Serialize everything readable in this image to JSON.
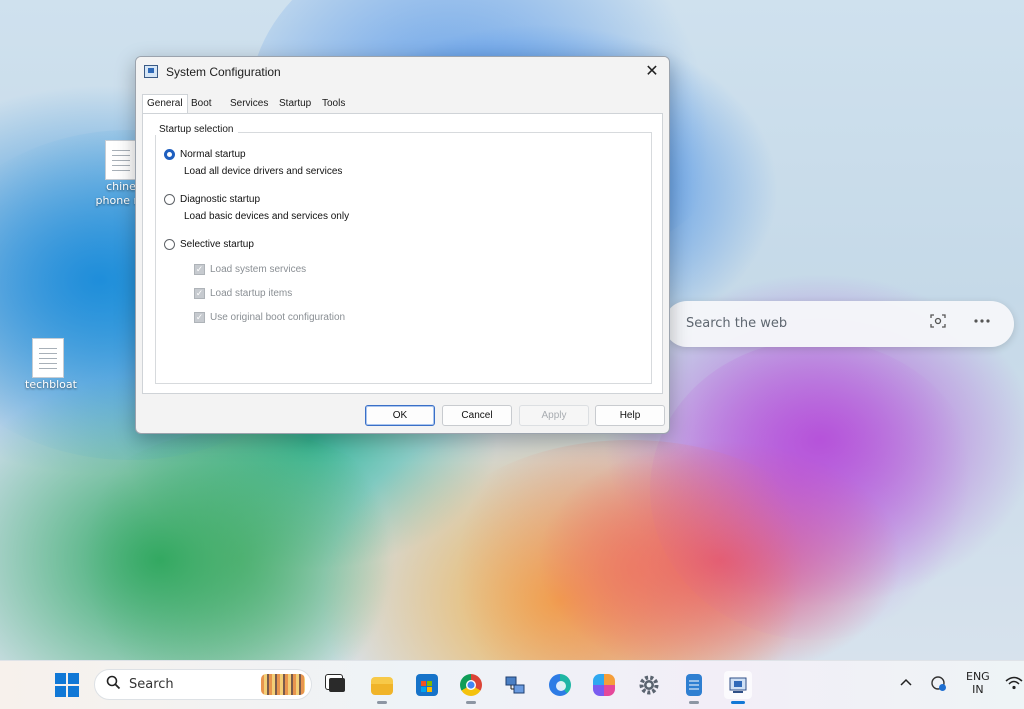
{
  "desktop": {
    "icons": [
      {
        "label_line1": "chine",
        "label_line2": "phone n"
      },
      {
        "label_line1": "techbloat"
      }
    ],
    "web_search": {
      "placeholder": "Search the web"
    }
  },
  "dialog": {
    "title": "System Configuration",
    "close_glyph": "✕",
    "tabs": [
      "General",
      "Boot",
      "Services",
      "Startup",
      "Tools"
    ],
    "active_tab": "General",
    "startup_selection": {
      "title": "Startup selection",
      "normal": {
        "label": "Normal startup",
        "desc": "Load all device drivers and services",
        "checked": true
      },
      "diagnostic": {
        "label": "Diagnostic startup",
        "desc": "Load basic devices and services only",
        "checked": false
      },
      "selective": {
        "label": "Selective startup",
        "checked": false,
        "options": [
          {
            "label": "Load system services",
            "checked": true,
            "disabled": true
          },
          {
            "label": "Load startup items",
            "checked": true,
            "disabled": true
          },
          {
            "label": "Use original boot configuration",
            "checked": true,
            "disabled": true
          }
        ]
      }
    },
    "buttons": {
      "ok": "OK",
      "cancel": "Cancel",
      "apply": "Apply",
      "help": "Help"
    }
  },
  "taskbar": {
    "search_label": "Search",
    "tray": {
      "lang_top": "ENG",
      "lang_bottom": "IN"
    },
    "colors": {
      "accent": "#1178d6"
    }
  }
}
